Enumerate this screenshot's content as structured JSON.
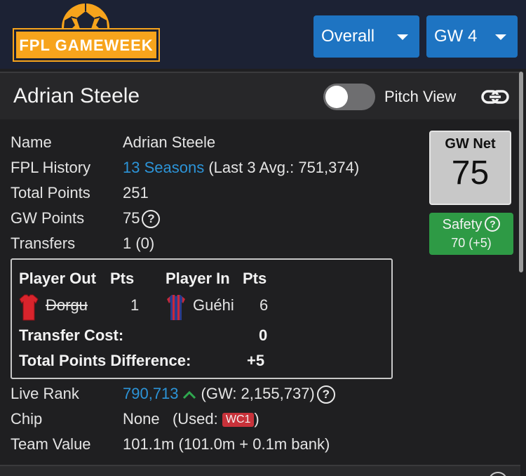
{
  "logo": {
    "text": "FPL GAMEWEEK"
  },
  "header": {
    "overall_label": "Overall",
    "gw_label": "GW 4"
  },
  "card": {
    "title": "Adrian Steele",
    "pitch_view_label": "Pitch View",
    "pitch_view_on": false
  },
  "info": {
    "name_label": "Name",
    "name_value": "Adrian Steele",
    "history_label": "FPL History",
    "history_link": "13 Seasons",
    "history_extra": "(Last 3 Avg.: 751,374)",
    "total_label": "Total Points",
    "total_value": "251",
    "gw_points_label": "GW Points",
    "gw_points_value": "75",
    "transfers_label": "Transfers",
    "transfers_value": "1 (0)",
    "live_rank_label": "Live Rank",
    "live_rank_value": "790,713",
    "live_rank_gw": "(GW: 2,155,737)",
    "chip_label": "Chip",
    "chip_value": "None",
    "chip_used_prefix": "(Used:",
    "chip_used_badge": "WC1",
    "chip_used_suffix": ")",
    "team_value_label": "Team Value",
    "team_value_value": "101.1m (101.0m + 0.1m bank)"
  },
  "transfer_box": {
    "out_header": "Player Out",
    "out_pts_header": "Pts",
    "in_header": "Player In",
    "in_pts_header": "Pts",
    "player_out": "Dorgu",
    "player_out_pts": "1",
    "player_in": "Guéhi",
    "player_in_pts": "6",
    "cost_label": "Transfer Cost:",
    "cost_value": "0",
    "diff_label": "Total Points Difference:",
    "diff_value": "+5"
  },
  "gw_net": {
    "label": "GW Net",
    "value": "75"
  },
  "safety": {
    "label": "Safety",
    "value": "70 (+5)"
  },
  "icons": {
    "help": "?",
    "link": "link-icon",
    "rank_trend": "arrow-up-icon"
  },
  "colors": {
    "accent_blue": "#1e74c2",
    "link_blue": "#2c94d8",
    "logo_orange": "#f7a41c",
    "safety_green": "#2e9a45",
    "rank_up_green": "#2fa84f",
    "chip_red": "#c8323a"
  }
}
